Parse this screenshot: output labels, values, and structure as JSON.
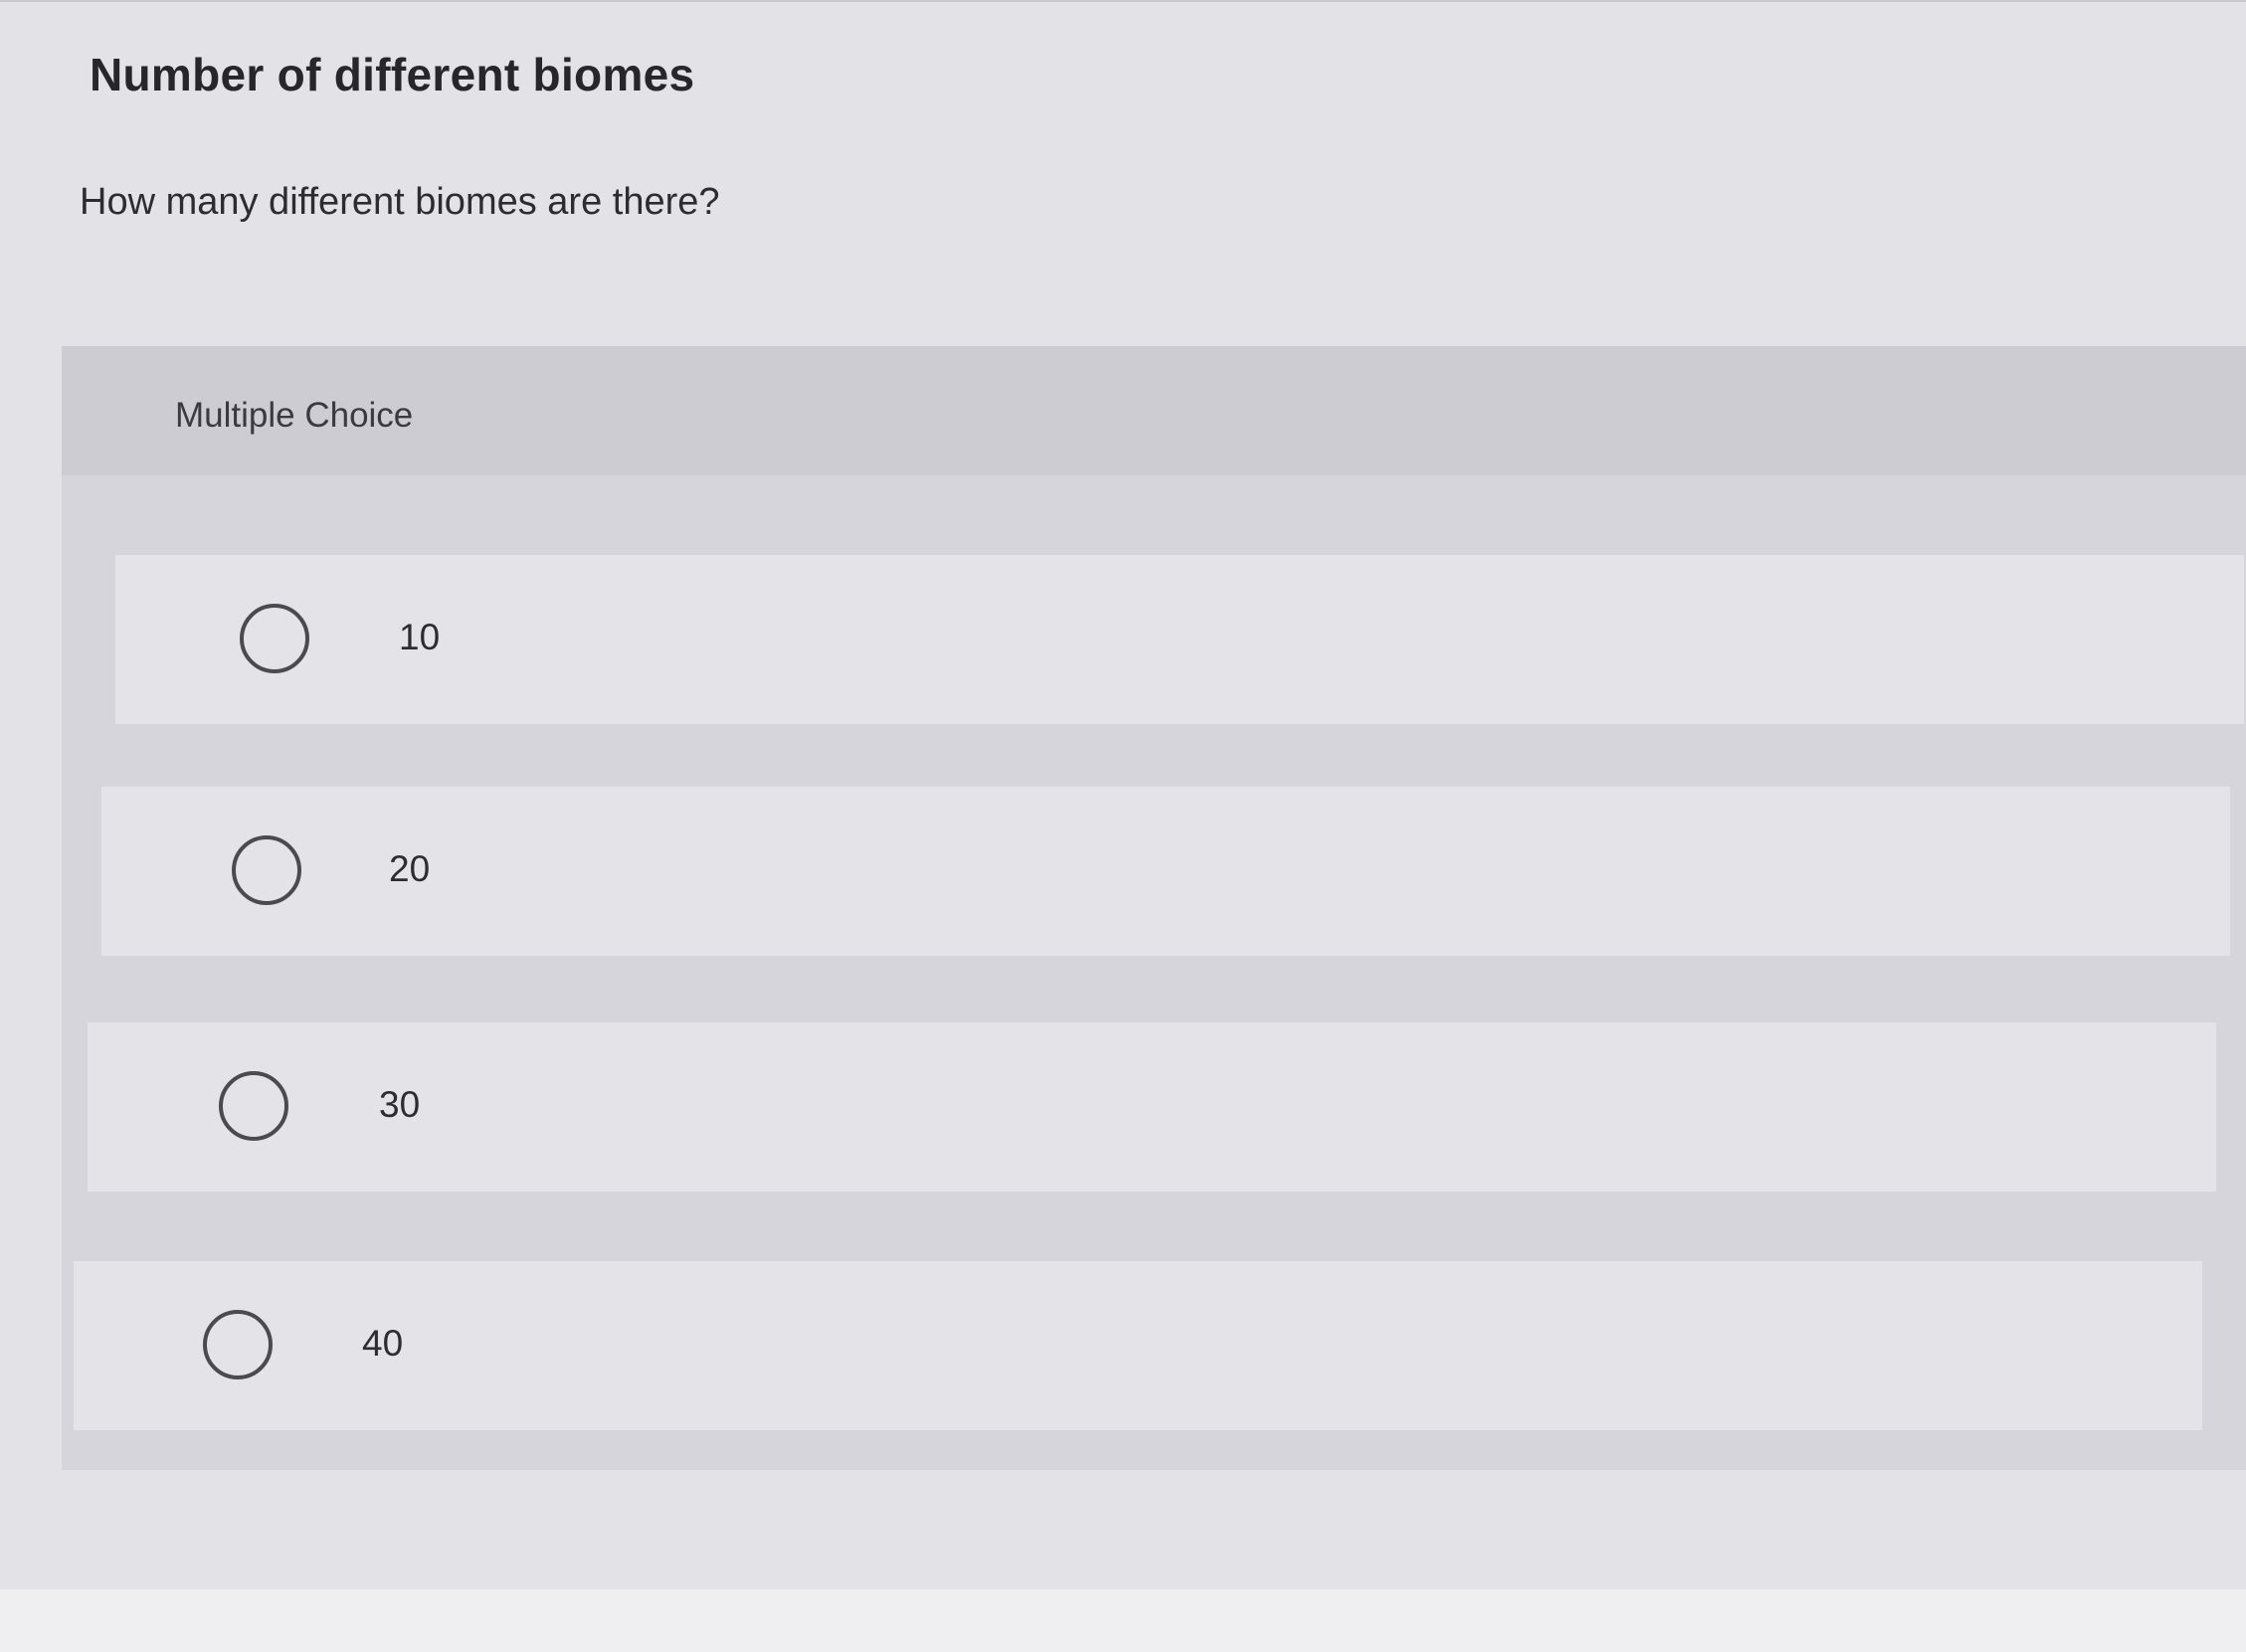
{
  "question": {
    "title": "Number of different biomes",
    "prompt": "How many different biomes are there?"
  },
  "panel": {
    "type_label": "Multiple Choice"
  },
  "choices": [
    {
      "label": "10",
      "selected": false
    },
    {
      "label": "20",
      "selected": false
    },
    {
      "label": "30",
      "selected": false
    },
    {
      "label": "40",
      "selected": false
    }
  ],
  "colors": {
    "background": "#e3e2e7",
    "panel": "#d6d5db",
    "panel_header": "#cdccd2",
    "choice_row": "#e4e3e8",
    "radio_border": "#4a4a50",
    "text": "#2a2a2e"
  },
  "icons": {
    "choice": "radio-unchecked-icon"
  }
}
